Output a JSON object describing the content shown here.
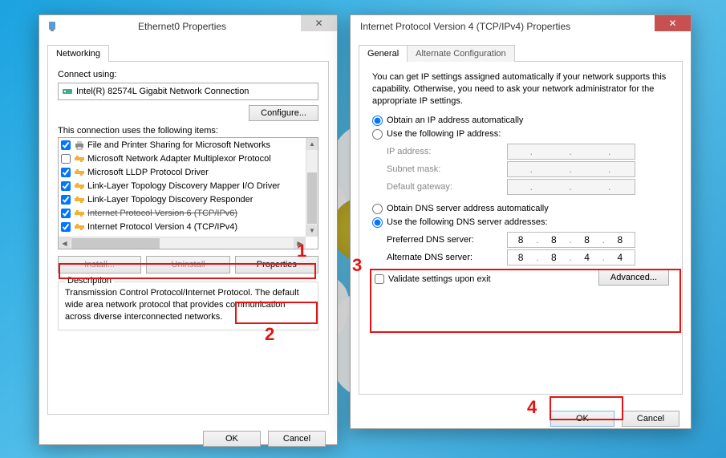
{
  "dlg1": {
    "title": "Ethernet0 Properties",
    "tab": "Networking",
    "connect_using_label": "Connect using:",
    "adapter": "Intel(R) 82574L Gigabit Network Connection",
    "configure_btn": "Configure...",
    "items_label": "This connection uses the following items:",
    "items": [
      {
        "checked": true,
        "icon": "printer",
        "label": "File and Printer Sharing for Microsoft Networks"
      },
      {
        "checked": false,
        "icon": "proto",
        "label": "Microsoft Network Adapter Multiplexor Protocol"
      },
      {
        "checked": true,
        "icon": "proto",
        "label": "Microsoft LLDP Protocol Driver"
      },
      {
        "checked": true,
        "icon": "proto",
        "label": "Link-Layer Topology Discovery Mapper I/O Driver"
      },
      {
        "checked": true,
        "icon": "proto",
        "label": "Link-Layer Topology Discovery Responder"
      },
      {
        "checked": true,
        "icon": "proto",
        "label": "Internet Protocol Version 6 (TCP/IPv6)"
      },
      {
        "checked": true,
        "icon": "proto",
        "label": "Internet Protocol Version 4 (TCP/IPv4)"
      }
    ],
    "install_btn": "Install...",
    "uninstall_btn": "Uninstall",
    "properties_btn": "Properties",
    "desc_title": "Description",
    "desc_text": "Transmission Control Protocol/Internet Protocol. The default wide area network protocol that provides communication across diverse interconnected networks.",
    "ok": "OK",
    "cancel": "Cancel"
  },
  "dlg2": {
    "title": "Internet Protocol Version 4 (TCP/IPv4) Properties",
    "tabs": {
      "general": "General",
      "alt": "Alternate Configuration"
    },
    "info": "You can get IP settings assigned automatically if your network supports this capability. Otherwise, you need to ask your network administrator for the appropriate IP settings.",
    "r_ip_auto": "Obtain an IP address automatically",
    "r_ip_manual": "Use the following IP address:",
    "ip_addr_label": "IP address:",
    "subnet_label": "Subnet mask:",
    "gateway_label": "Default gateway:",
    "r_dns_auto": "Obtain DNS server address automatically",
    "r_dns_manual": "Use the following DNS server addresses:",
    "pref_dns_label": "Preferred DNS server:",
    "alt_dns_label": "Alternate DNS server:",
    "pref_dns": [
      "8",
      "8",
      "8",
      "8"
    ],
    "alt_dns": [
      "8",
      "8",
      "4",
      "4"
    ],
    "validate": "Validate settings upon exit",
    "advanced": "Advanced...",
    "ok": "OK",
    "cancel": "Cancel"
  },
  "annotations": {
    "n1": "1",
    "n2": "2",
    "n3": "3",
    "n4": "4"
  },
  "colors": {
    "annotation": "#e31313",
    "close_red": "#c75050"
  }
}
